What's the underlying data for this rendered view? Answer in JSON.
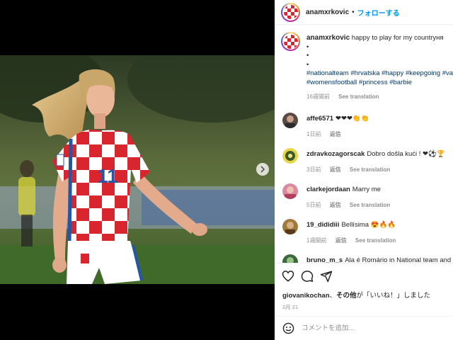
{
  "post": {
    "username": "anamxrkovic",
    "follow_label": "フォローする",
    "separator": "•",
    "caption": {
      "text": "happy to play for my countryня",
      "bullets": [
        "•",
        "•",
        "•"
      ],
      "tags_line1": "#nationalteam #hrvatska #happy #keepgoing #vamos",
      "tags_line2": "#womensfootball #princess #barbie",
      "time": "16週間前",
      "see_translation": "See translation"
    },
    "comments": [
      {
        "user": "affe6571",
        "text": "❤❤❤👏👏",
        "time": "1日前",
        "reply": "返信",
        "translate": ""
      },
      {
        "user": "zdravkozagorscak",
        "text": "Dobro došla kući ! ❤⚽🏆",
        "time": "3日前",
        "reply": "返信",
        "translate": "See translation"
      },
      {
        "user": "clarkejordaan",
        "text": "Marry me",
        "time": "5日前",
        "reply": "返信",
        "translate": "See translation"
      },
      {
        "user": "19_dididiii",
        "text": "Bellísima 😍🔥🔥",
        "time": "1週間前",
        "reply": "返信",
        "translate": "See translation"
      },
      {
        "user": "bruno_m_s",
        "text": "Ala é Romário in National team and D",
        "time": "",
        "reply": "",
        "translate": ""
      }
    ],
    "likes": {
      "user": "giovanikochan",
      "connector": "、",
      "others": "その他",
      "suffix": "が「いいね！」しました"
    },
    "date": "2月 21",
    "comment_placeholder": "コメントを追加...",
    "photo": {
      "jersey_number": "11"
    }
  },
  "icons": {
    "like": "heart-icon",
    "comment": "speech-bubble-icon",
    "share": "paper-plane-icon",
    "emoji": "smiley-icon",
    "next": "chevron-right-icon"
  },
  "colors": {
    "accent": "#0095f6",
    "hashtag": "#00376b",
    "muted": "#8e8e8e",
    "text": "#262626"
  }
}
